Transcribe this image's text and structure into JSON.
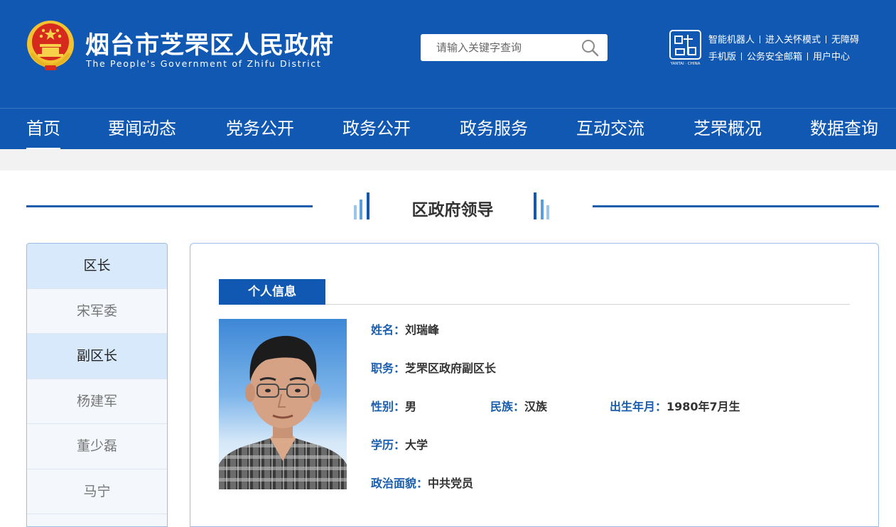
{
  "header": {
    "title": "烟台市芝罘区人民政府",
    "subtitle": "The People's Government of Zhifu District",
    "search_placeholder": "请输入关键字查询",
    "seal_text_small": "YANTAI · CHINA",
    "top_links_row1": [
      "智能机器人",
      "进入关怀模式",
      "无障碍"
    ],
    "top_links_row2": [
      "手机版",
      "公务安全邮箱",
      "用户中心"
    ]
  },
  "nav": {
    "items": [
      "首页",
      "要闻动态",
      "党务公开",
      "政务公开",
      "政务服务",
      "互动交流",
      "芝罘概况",
      "数据查询"
    ],
    "active_index": 0
  },
  "section": {
    "title": "区政府领导"
  },
  "sidebar": {
    "items": [
      {
        "label": "区长",
        "type": "head"
      },
      {
        "label": "宋军委",
        "type": "person"
      },
      {
        "label": "副区长",
        "type": "head"
      },
      {
        "label": "杨建军",
        "type": "person"
      },
      {
        "label": "董少磊",
        "type": "person"
      },
      {
        "label": "马宁",
        "type": "person"
      }
    ]
  },
  "profile": {
    "tab_label": "个人信息",
    "name_label": "姓名：",
    "name": "刘瑞峰",
    "position_label": "职务：",
    "position": "芝罘区政府副区长",
    "gender_label": "性别：",
    "gender": "男",
    "ethnicity_label": "民族：",
    "ethnicity": "汉族",
    "birth_label": "出生年月：",
    "birth": "1980年7月生",
    "education_label": "学历：",
    "education": "大学",
    "political_label": "政治面貌：",
    "political": "中共党员"
  },
  "colors": {
    "brand_blue": "#1158b2",
    "sidebar_head_bg": "#d8e9fb",
    "label_blue": "#1a5ead"
  }
}
